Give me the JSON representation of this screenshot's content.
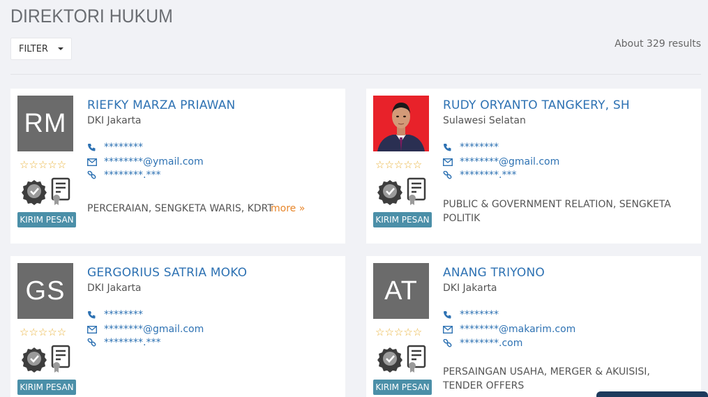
{
  "page": {
    "title": "DIREKTORI HUKUM",
    "filter_label": "FILTER",
    "results_text": "About 329 results"
  },
  "cards": [
    {
      "initials": "RM",
      "name": "RIEFKY MARZA PRIAWAN",
      "location": "DKI Jakarta",
      "phone": "********",
      "email": "********@ymail.com",
      "website": "********.***",
      "specialties": "PERCERAIAN, SENGKETA WARIS, KDRT",
      "more_label": "more »",
      "stars": "☆☆☆☆☆",
      "send_label": "KIRIM PESAN"
    },
    {
      "initials": "",
      "name": "RUDY ORYANTO TANGKERY, SH",
      "location": "Sulawesi Selatan",
      "phone": "********",
      "email": "********@gmail.com",
      "website": "********.***",
      "specialties": "PUBLIC & GOVERNMENT RELATION, SENGKETA POLITIK",
      "stars": "☆☆☆☆☆",
      "send_label": "KIRIM PESAN"
    },
    {
      "initials": "GS",
      "name": "GERGORIUS SATRIA MOKO",
      "location": "DKI Jakarta",
      "phone": "********",
      "email": "********@gmail.com",
      "website": "********.***",
      "stars": "☆☆☆☆☆",
      "send_label": "KIRIM PESAN"
    },
    {
      "initials": "AT",
      "name": "ANANG TRIYONO",
      "location": "DKI Jakarta",
      "phone": "********",
      "email": "********@makarim.com",
      "website": "********.com",
      "specialties": "PERSAINGAN USAHA, MERGER & AKUISISI, TENDER OFFERS",
      "stars": "☆☆☆☆☆",
      "send_label": "KIRIM PESAN"
    }
  ],
  "colors": {
    "background": "#f1f2f6",
    "link_blue": "#2e72b3",
    "button_teal": "#4b8fa8",
    "star_gold": "#e9b23a",
    "more_orange": "#e8862a",
    "avatar_gray": "#6b6b6b"
  },
  "icons": [
    "phone-icon",
    "email-icon",
    "link-icon",
    "verified-seal-icon",
    "certificate-icon",
    "caret-down-icon"
  ]
}
